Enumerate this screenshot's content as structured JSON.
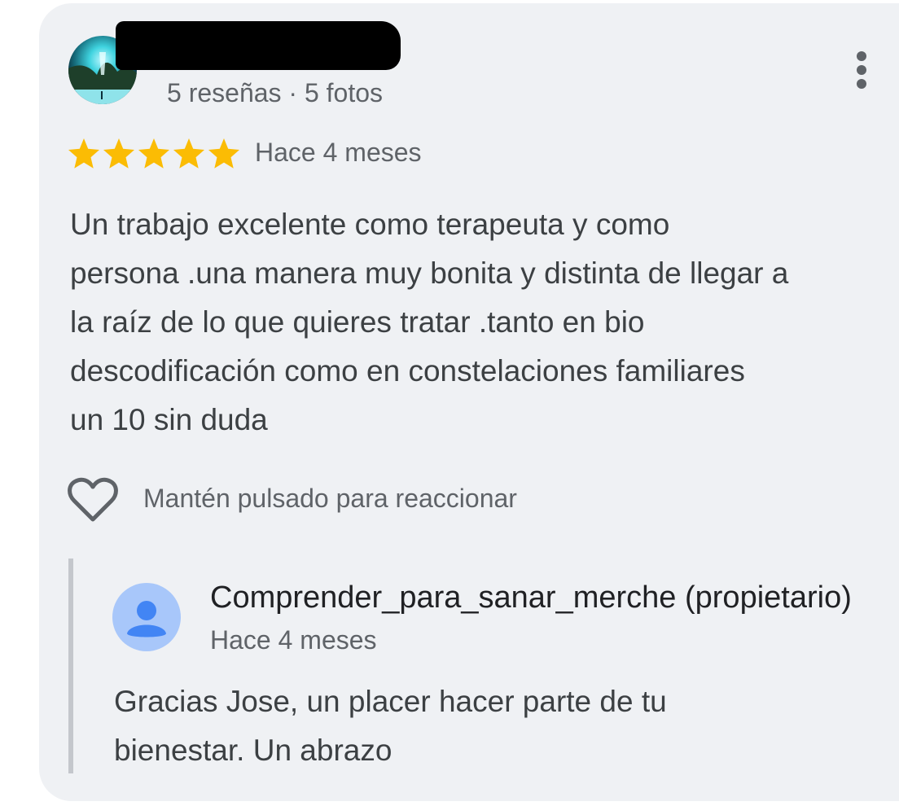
{
  "review": {
    "author_stats": "5 reseñas · 5 fotos",
    "rating": 5,
    "rating_max": 5,
    "date": "Hace 4 meses",
    "text_lines": [
      "Un trabajo excelente como terapeuta y como",
      "persona .una manera muy bonita y distinta de llegar a",
      "la raíz de lo que quieres tratar .tanto en bio",
      "descodificación como en constelaciones familiares",
      "un 10 sin duda"
    ],
    "react_label": "Mantén pulsado para reaccionar"
  },
  "owner_reply": {
    "name": "Comprender_para_sanar_merche (propietario)",
    "date": "Hace 4 meses",
    "text_lines": [
      "Gracias Jose, un placer hacer parte de tu",
      "bienestar. Un abrazo"
    ]
  },
  "icons": {
    "more": "more-vert-icon",
    "heart": "heart-outline-icon",
    "star": "star-icon",
    "owner_avatar": "default-person-avatar-icon"
  },
  "colors": {
    "card_background": "#eff1f4",
    "star": "#fbbc04",
    "secondary_text": "#5f6368",
    "body_text": "#3c4043",
    "owner_avatar_bg": "#a8c7fa",
    "owner_avatar_fg": "#4285f4"
  }
}
